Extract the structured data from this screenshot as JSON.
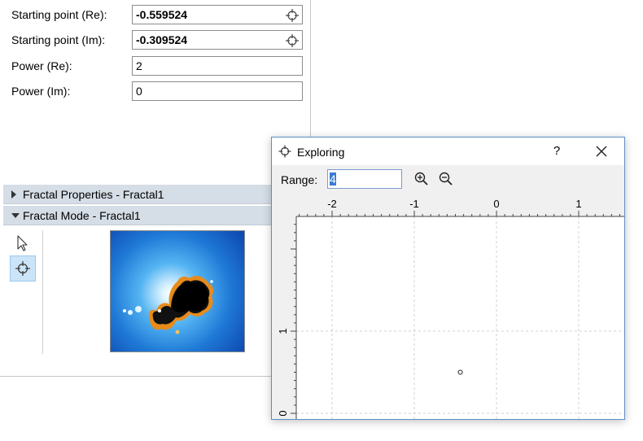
{
  "properties": {
    "rows": [
      {
        "label": "Starting point (Re):",
        "value": "-0.559524",
        "bold": true,
        "picker": true
      },
      {
        "label": "Starting point (Im):",
        "value": "-0.309524",
        "bold": true,
        "picker": true
      },
      {
        "label": "Power (Re):",
        "value": "2",
        "bold": false,
        "picker": false
      },
      {
        "label": "Power (Im):",
        "value": "0",
        "bold": false,
        "picker": false
      }
    ]
  },
  "sections": {
    "fractal_properties": "Fractal Properties - Fractal1",
    "fractal_mode": "Fractal Mode - Fractal1"
  },
  "mode_tools": [
    {
      "name": "pointer-icon",
      "selected": false
    },
    {
      "name": "crosshair-icon",
      "selected": true
    }
  ],
  "dialog": {
    "title": "Exploring",
    "help": "?",
    "range_label": "Range:",
    "range_value": "4",
    "zoom_in_icon": "zoom-in-icon",
    "zoom_out_icon": "zoom-out-icon"
  },
  "plot": {
    "x_ticks": [
      {
        "value": -2,
        "label": "-2"
      },
      {
        "value": -1,
        "label": "-1"
      },
      {
        "value": 0,
        "label": "0"
      },
      {
        "value": 1,
        "label": "1"
      }
    ],
    "y_ticks": [
      {
        "value": 1,
        "label": "1"
      },
      {
        "value": 0,
        "label": "0"
      }
    ],
    "marker": {
      "re": -0.44,
      "im": 0.5
    },
    "grid": true
  },
  "colors": {
    "section_header": "#d5dde6",
    "selected_tool": "#cce4f7",
    "dialog_border": "#5a8fc5",
    "selection": "#3a7bd5"
  }
}
